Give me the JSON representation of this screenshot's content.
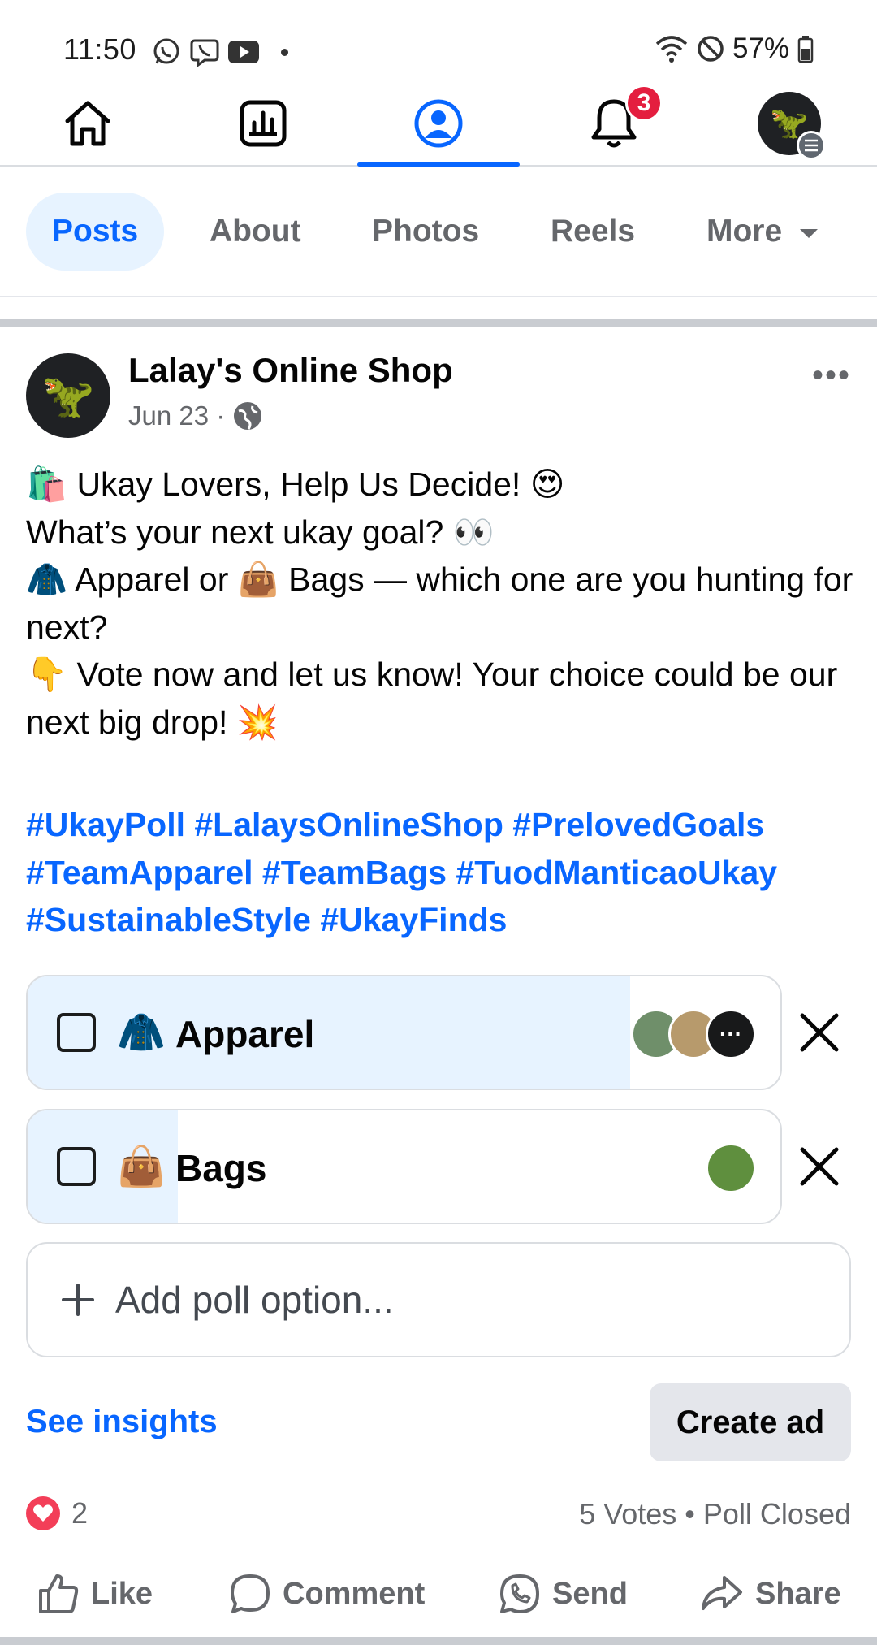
{
  "status_bar": {
    "time": "11:50",
    "battery": "57%"
  },
  "nav": {
    "notification_count": "3"
  },
  "tabs": {
    "items": [
      "Posts",
      "About",
      "Photos",
      "Reels",
      "More"
    ],
    "active": "Posts"
  },
  "post": {
    "author": "Lalay's Online Shop",
    "date": "Jun 23 ·",
    "lines": [
      "🛍️ Ukay Lovers, Help Us Decide! 😍",
      "What’s your next ukay goal? 👀",
      "🧥 Apparel or 👜 Bags — which one are you hunting for next?",
      "👇 Vote now and let us know! Your choice could be our next big drop! 💥"
    ],
    "hashtags": "#UkayPoll #LalaysOnlineShop #PrelovedGoals #TeamApparel #TeamBags #TuodManticaoUkay #SustainableStyle #UkayFinds"
  },
  "poll": {
    "options": [
      {
        "emoji": "🧥",
        "label": "Apparel",
        "vote_share": 0.8
      },
      {
        "emoji": "👜",
        "label": "Bags",
        "vote_share": 0.2
      }
    ],
    "more_voters": "···",
    "add_option": "Add poll option..."
  },
  "footer": {
    "see_insights": "See insights",
    "create_ad": "Create ad",
    "reaction_count": "2",
    "votes_status": "5 Votes • Poll Closed"
  },
  "actions": {
    "like": "Like",
    "comment": "Comment",
    "send": "Send",
    "share": "Share"
  },
  "colors": {
    "accent": "#0866ff",
    "badge": "#e41e3f",
    "poll_fill": "#e7f3ff"
  }
}
